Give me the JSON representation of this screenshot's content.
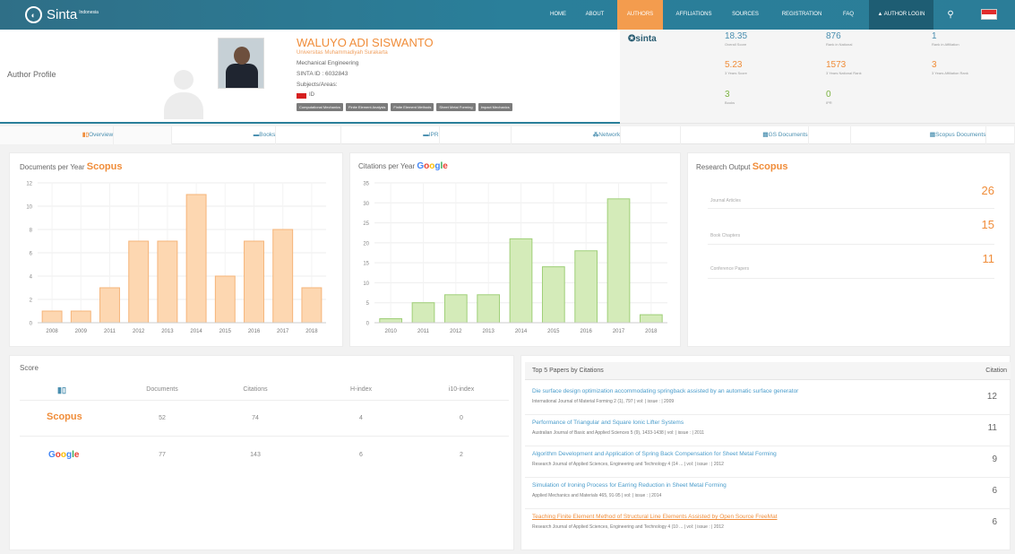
{
  "header": {
    "brand": "Sinta",
    "brand_sup": "Indonesia",
    "nav": [
      {
        "label": "HOME"
      },
      {
        "label": "ABOUT"
      },
      {
        "label": "AUTHORS"
      },
      {
        "label": "AFFILIATIONS"
      },
      {
        "label": "SOURCES"
      },
      {
        "label": "REGISTRATION"
      },
      {
        "label": "FAQ"
      }
    ],
    "login_label": "▲ AUTHOR LOGIN",
    "search_icon": "⚲",
    "active_color": "#f39c4e"
  },
  "profile": {
    "page_label": "Author Profile",
    "name": "WALUYO ADI SISWANTO",
    "university": "Universitas Muhammadiyah Surakarta",
    "department": "Mechanical Engineering",
    "sinta_id": "SINTA ID : 6032843",
    "subjects_label": "Subjects/Areas:",
    "country": "ID",
    "tags": [
      "Computational Mechanics",
      "Finite Element Analysis",
      "Finite Element Methods",
      "Sheet Metal Forming",
      "Impact Mechanics"
    ]
  },
  "stats": {
    "sinta_logo": "sinta",
    "overall_score": {
      "value": "18.35",
      "label": "Overall Score"
    },
    "rank_national": {
      "value": "876",
      "label": "Rank in National"
    },
    "rank_affiliation": {
      "value": "1",
      "label": "Rank in Affiliation"
    },
    "score_3yr": {
      "value": "5.23",
      "label": "3 Years Score"
    },
    "rank_national_3yr": {
      "value": "1573",
      "label": "3 Years National Rank"
    },
    "rank_affiliation_3yr": {
      "value": "3",
      "label": "3 Years Affiliation Rank"
    },
    "books": {
      "value": "3",
      "label": "Books"
    },
    "ipr": {
      "value": "0",
      "label": "IPR"
    }
  },
  "tabs": [
    {
      "label": "Overview",
      "icon": "chart-icon"
    },
    {
      "label": "Books",
      "icon": "book-icon"
    },
    {
      "label": "IPR",
      "icon": "ipr-icon"
    },
    {
      "label": "Network",
      "icon": "network-icon"
    },
    {
      "label": "GS Documents",
      "icon": "document-icon"
    },
    {
      "label": "Scopus Documents",
      "icon": "document-icon"
    }
  ],
  "charts": {
    "docs_title": "Documents per Year",
    "docs_logo": "Scopus",
    "cites_title": "Citations per Year",
    "cites_logo": "Google"
  },
  "chart_data": [
    {
      "type": "bar",
      "title": "Documents per Year",
      "categories": [
        "2008",
        "2009",
        "2011",
        "2012",
        "2013",
        "2014",
        "2015",
        "2016",
        "2017",
        "2018"
      ],
      "values": [
        1,
        1,
        3,
        7,
        7,
        11,
        4,
        7,
        8,
        3
      ],
      "ylim": [
        0,
        12
      ],
      "yticks": [
        0,
        2,
        4,
        6,
        8,
        10,
        12
      ],
      "color": "#fdd7b1",
      "stroke": "#f5b479",
      "grid": true
    },
    {
      "type": "bar",
      "title": "Citations per Year",
      "categories": [
        "2010",
        "2011",
        "2012",
        "2013",
        "2014",
        "2015",
        "2016",
        "2017",
        "2018"
      ],
      "values": [
        1,
        5,
        7,
        7,
        21,
        14,
        18,
        31,
        2
      ],
      "ylim": [
        0,
        35
      ],
      "yticks": [
        0,
        5,
        10,
        15,
        20,
        25,
        30,
        35
      ],
      "color": "#d4ebb9",
      "stroke": "#9fcf78",
      "grid": true
    }
  ],
  "research_output": {
    "title": "Research Output",
    "logo": "Scopus",
    "items": [
      {
        "label": "Journal Articles",
        "value": "26"
      },
      {
        "label": "Book Chapters",
        "value": "15"
      },
      {
        "label": "Conference Papers",
        "value": "11"
      }
    ]
  },
  "score": {
    "title": "Score",
    "headers": [
      "Documents",
      "Citations",
      "H-index",
      "i10-index"
    ],
    "rows": [
      {
        "source": "Scopus",
        "values": [
          "52",
          "74",
          "4",
          "0"
        ]
      },
      {
        "source": "Google",
        "values": [
          "77",
          "143",
          "6",
          "2"
        ]
      }
    ]
  },
  "top_papers": {
    "title": "Top 5 Papers by Citations",
    "citation_header": "Citation",
    "items": [
      {
        "title": "Die surface design optimization accommodating springback assisted by an automatic surface generator",
        "source": "International Journal of Material Forming 2 (1), 797 | vol: | issue : | 2009",
        "citations": "12"
      },
      {
        "title": "Performance of Triangular and Square Ionic Lifter Systems",
        "source": "Australian Journal of Basic and Applied Sciences 5 (9), 1433-1438 | vol: | issue : | 2011",
        "citations": "11"
      },
      {
        "title": "Algorithm Development and Application of Spring Back Compensation for Sheet Metal Forming",
        "source": "Research Journal of Applied Sciences, Engineering and Technology 4 (14 ... | vol: | issue : | 2012",
        "citations": "9"
      },
      {
        "title": "Simulation of Ironing Process for Earring Reduction in Sheet Metal Forming",
        "source": "Applied Mechanics and Materials 465, 91-95 | vol: | issue : | 2014",
        "citations": "6"
      },
      {
        "title": "Teaching Finite Element Method of Structural Line Elements Assisted by Open Source FreeMat",
        "source": "Research Journal of Applied Sciences, Engineering and Technology 4 (10 ... | vol: | issue : | 2012",
        "citations": "6"
      }
    ]
  }
}
